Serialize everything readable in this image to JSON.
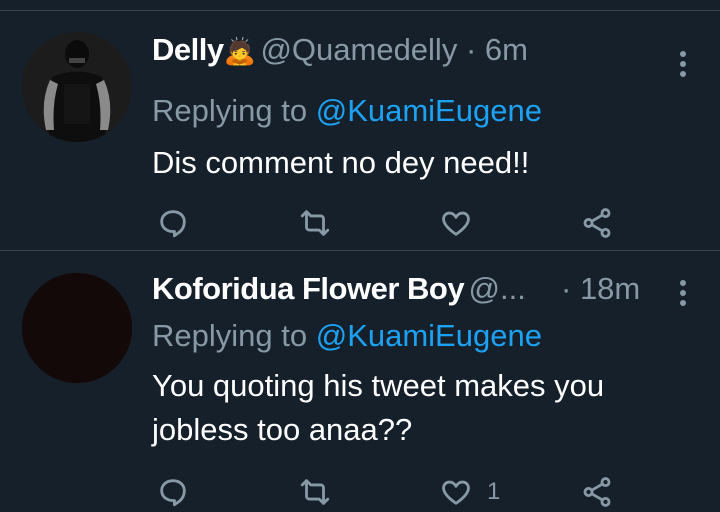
{
  "tweets": [
    {
      "name": "Delly",
      "name_emoji": "🙇",
      "handle": "@Quamedelly",
      "time": "6m",
      "replying_prefix": "Replying to",
      "replying_to": "@KuamiEugene",
      "text": "Dis comment no dey need!!",
      "like_count": ""
    },
    {
      "name": "Koforidua Flower Boy",
      "handle": "@...",
      "time": "18m",
      "replying_prefix": "Replying to",
      "replying_to": "@KuamiEugene",
      "text": "You quoting his tweet makes you jobless too anaa??",
      "like_count": "1"
    }
  ],
  "colors": {
    "background": "#15202b",
    "muted": "#8899a6",
    "accent": "#1da1f2",
    "divider": "#38444d"
  },
  "icons": [
    "more-vertical-icon",
    "reply-icon",
    "retweet-icon",
    "like-icon",
    "share-icon"
  ]
}
